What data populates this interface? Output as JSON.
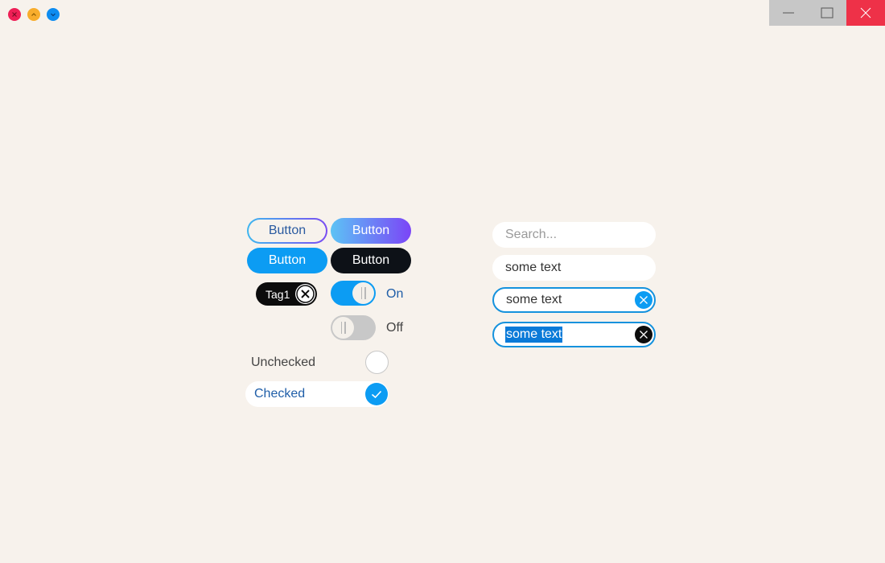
{
  "window": {
    "traffic_lights": [
      "close-icon",
      "minimize-icon",
      "maximize-icon"
    ],
    "controls": [
      "minimize-icon",
      "maximize-icon",
      "close-icon"
    ]
  },
  "buttons": {
    "outline": "Button",
    "gradient": "Button",
    "primary": "Button",
    "dark": "Button"
  },
  "tag": {
    "label": "Tag1"
  },
  "toggles": {
    "on_label": "On",
    "off_label": "Off"
  },
  "checkboxes": {
    "unchecked_label": "Unchecked",
    "checked_label": "Checked"
  },
  "fields": {
    "search_placeholder": "Search...",
    "plain_value": "some text",
    "focused_value": "some text",
    "selected_value": "some text"
  },
  "colors": {
    "background": "#f7f2ec",
    "accent": "#0c9cf3",
    "dark": "#0d1117",
    "gradient_start": "#5cc3f5",
    "gradient_end": "#7b45f7"
  }
}
